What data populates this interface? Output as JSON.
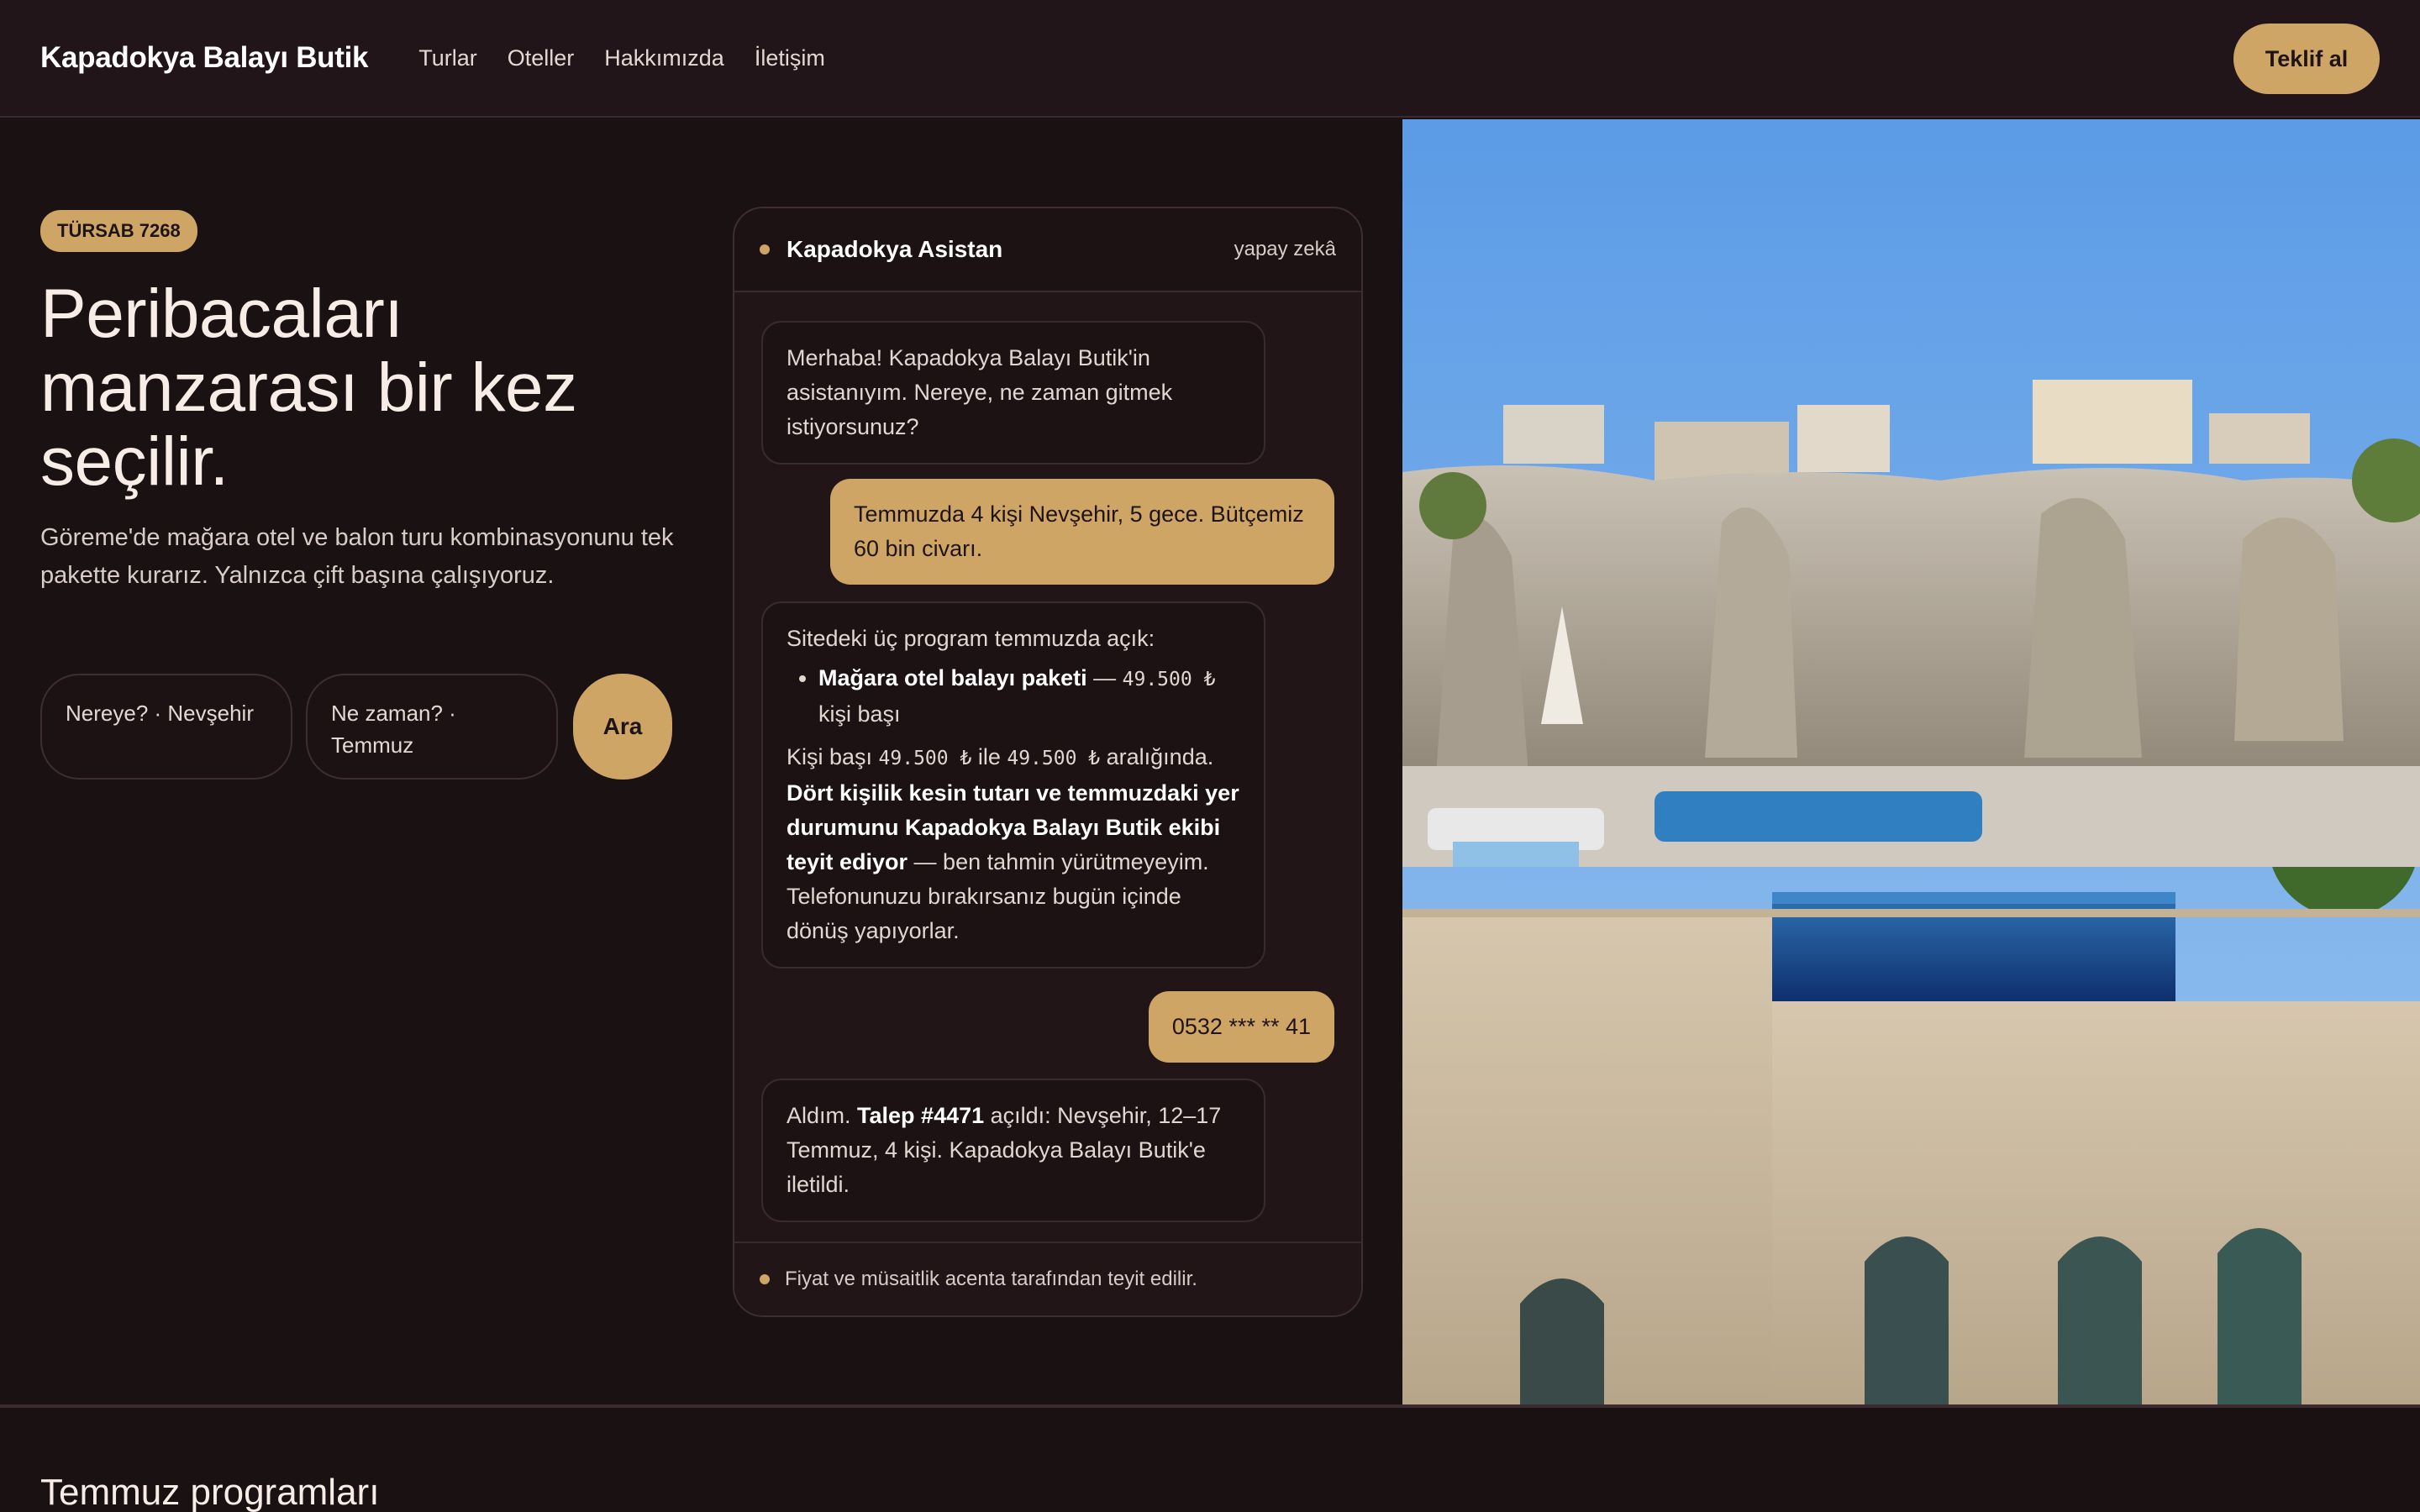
{
  "header": {
    "brand": "Kapadokya Balayı Butik",
    "nav": [
      "Turlar",
      "Oteller",
      "Hakkımızda",
      "İletişim"
    ],
    "cta_label": "Teklif al"
  },
  "hero": {
    "badge": "TÜRSAB 7268",
    "headline": "Peribacaları manzarası bir kez seçilir.",
    "lede": "Göreme'de mağara otel ve balon turu kombinasyonunu tek pakette kurarız. Yalnızca çift başına çalışıyoruz.",
    "search": {
      "where_label": "Nereye? · Nevşehir",
      "when_label": "Ne zaman? · Temmuz",
      "button_label": "Ara"
    }
  },
  "chat": {
    "title": "Kapadokya Asistan",
    "tag": "yapay zekâ",
    "messages": [
      {
        "text": "Merhaba! Kapadokya Balayı Butik'in asistanıyım. Nereye, ne zaman gitmek istiyorsunuz?"
      },
      {
        "text": "Temmuzda 4 kişi Nevşehir, 5 gece. Bütçemiz 60 bin civarı."
      },
      {
        "intro": "Sitedeki üç program temmuzda açık:",
        "item_name": "Mağara otel balayı paketi",
        "item_sep": " — ",
        "item_price": "49.500 ₺",
        "item_unit": " kişi başı",
        "range_prefix": "Kişi başı ",
        "range_low": "49.500 ₺",
        "range_mid": " ile ",
        "range_high": "49.500 ₺",
        "range_suffix": " aralığında. ",
        "bold": "Dört kişilik kesin tutarı ve temmuzdaki yer durumunu Kapadokya Balayı Butik ekibi teyit ediyor",
        "tail": " — ben tahmin yürütmeyeyim. Telefonunuzu bırakırsanız bugün içinde dönüş yapıyorlar."
      },
      {
        "text": "0532 *** ** 41"
      },
      {
        "prefix": "Aldım. ",
        "bold": "Talep #4471",
        "suffix": " açıldı: Nevşehir, 12–17 Temmuz, 4 kişi. Kapadokya Balayı Butik'e iletildi."
      }
    ],
    "footer": "Fiyat ve müsaitlik acenta tarafından teyit edilir."
  },
  "below": {
    "section_title": "Temmuz programları"
  },
  "colors": {
    "accent": "#cfa566",
    "bg": "#1a1113",
    "panel": "#221518"
  }
}
